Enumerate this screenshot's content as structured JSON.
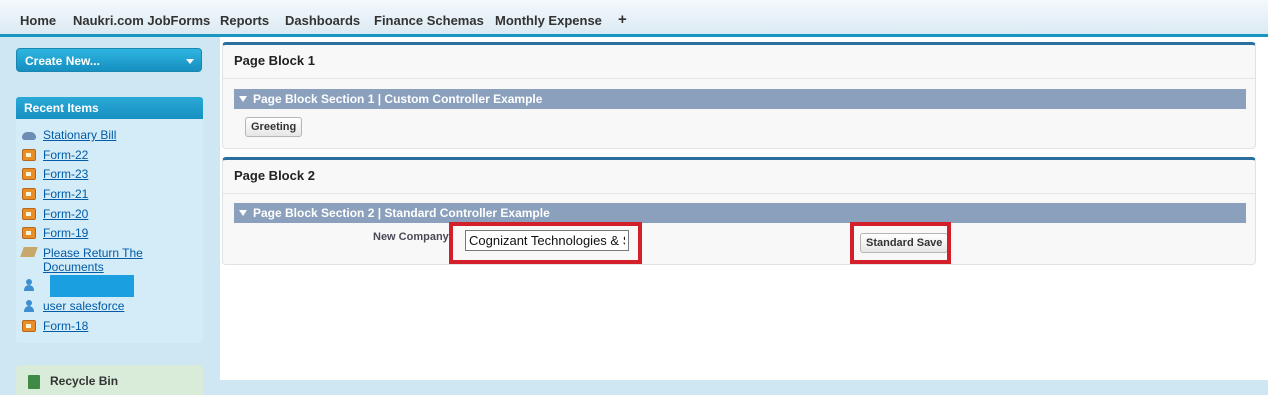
{
  "tabs": [
    "Home",
    "Naukri.com JobForms",
    "Reports",
    "Dashboards",
    "Finance Schemas",
    "Monthly Expense",
    "+"
  ],
  "sidebar": {
    "create_new": "Create New...",
    "recent_title": "Recent Items",
    "recent_items": [
      {
        "label": "Stationary Bill",
        "icon": "car-icon"
      },
      {
        "label": "Form-22",
        "icon": "form-icon"
      },
      {
        "label": "Form-23",
        "icon": "form-icon"
      },
      {
        "label": "Form-21",
        "icon": "form-icon"
      },
      {
        "label": "Form-20",
        "icon": "form-icon"
      },
      {
        "label": "Form-19",
        "icon": "form-icon"
      },
      {
        "label": "Please Return The",
        "label2": "Documents",
        "icon": "document-icon"
      },
      {
        "label": "",
        "icon": "user-icon",
        "redacted": true
      },
      {
        "label": "user salesforce",
        "icon": "user-icon"
      },
      {
        "label": "Form-18",
        "icon": "form-icon"
      }
    ],
    "recycle_bin": "Recycle Bin"
  },
  "block1": {
    "title": "Page Block 1",
    "section": "Page Block Section 1 | Custom Controller Example",
    "button": "Greeting"
  },
  "block2": {
    "title": "Page Block 2",
    "section": "Page Block Section 2 | Standard Controller Example",
    "field_label": "New Company:",
    "field_value": "Cognizant Technologies & Se",
    "button": "Standard Save"
  },
  "colors": {
    "accent": "#1797c0",
    "section_bar": "#8aa0bd",
    "highlight": "#d21f2a"
  }
}
